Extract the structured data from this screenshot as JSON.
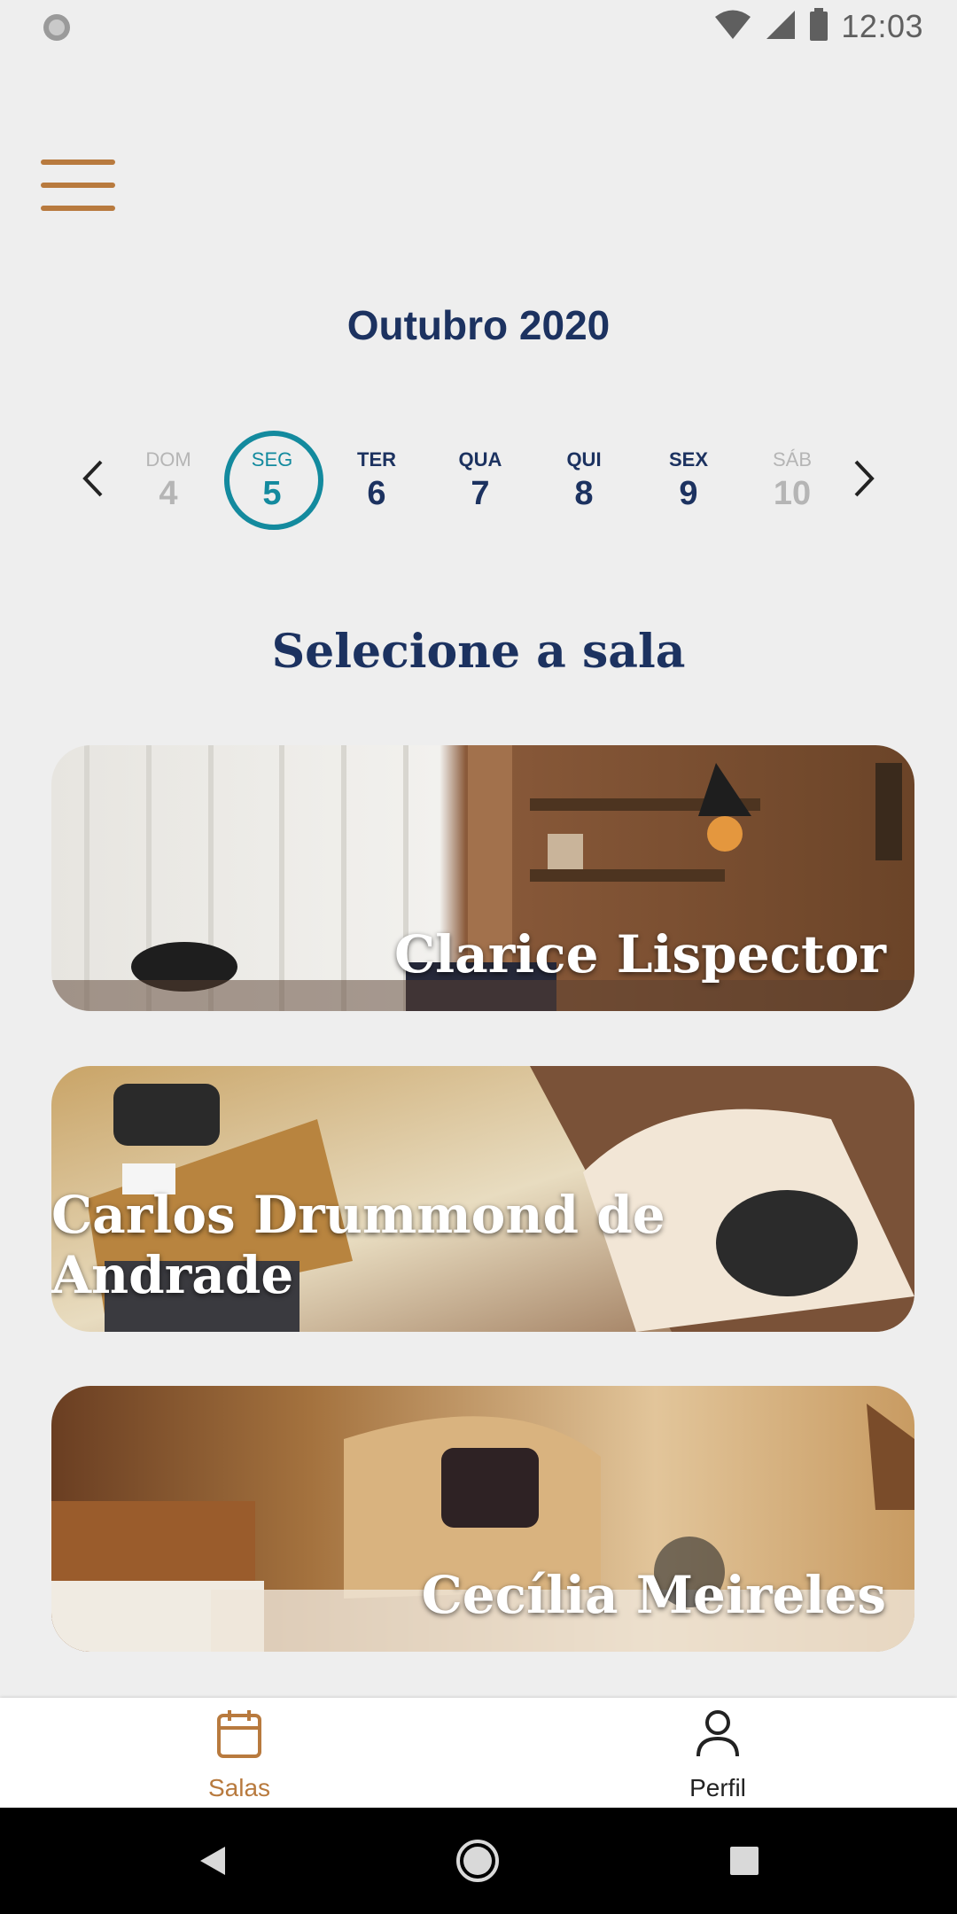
{
  "status_bar": {
    "time": "12:03",
    "icons": [
      "sync-icon",
      "wifi-icon",
      "signal-icon",
      "battery-icon"
    ]
  },
  "header": {
    "menu_icon": "hamburger-menu-icon",
    "month_title": "Outubro 2020"
  },
  "calendar": {
    "days": [
      {
        "dow": "DOM",
        "num": "4",
        "state": "muted"
      },
      {
        "dow": "SEG",
        "num": "5",
        "state": "selected"
      },
      {
        "dow": "TER",
        "num": "6",
        "state": "normal"
      },
      {
        "dow": "QUA",
        "num": "7",
        "state": "normal"
      },
      {
        "dow": "QUI",
        "num": "8",
        "state": "normal"
      },
      {
        "dow": "SEX",
        "num": "9",
        "state": "normal"
      },
      {
        "dow": "SÁB",
        "num": "10",
        "state": "muted"
      }
    ]
  },
  "rooms": {
    "title": "Selecione a sala",
    "items": [
      {
        "name": "Clarice Lispector"
      },
      {
        "name": "Carlos Drummond de Andrade"
      },
      {
        "name": "Cecília Meireles"
      }
    ]
  },
  "bottom_nav": {
    "items": [
      {
        "label": "Salas",
        "icon": "calendar-icon",
        "active": true
      },
      {
        "label": "Perfil",
        "icon": "person-icon",
        "active": false
      }
    ]
  },
  "colors": {
    "accent": "#b87a3e",
    "primary": "#1c3260",
    "selected_day": "#138a9e",
    "background": "#eeeeee"
  }
}
